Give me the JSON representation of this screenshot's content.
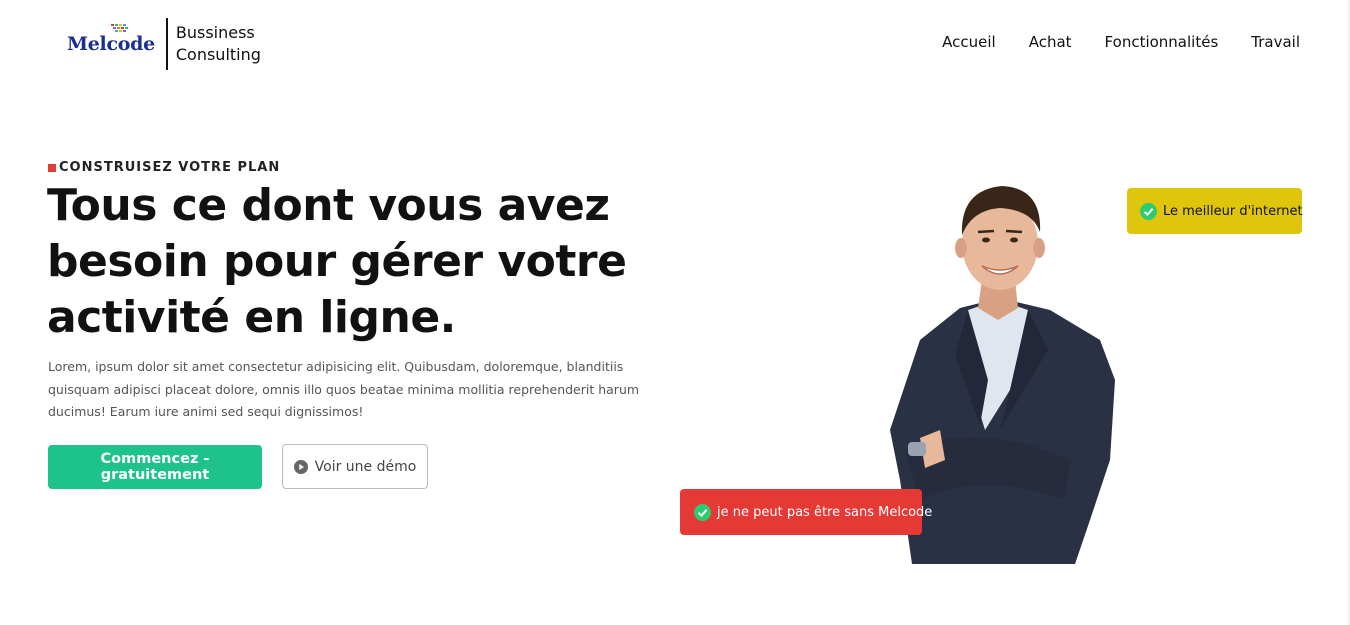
{
  "header": {
    "logo": {
      "brand": "Melcode",
      "tagline_line1": "Bussiness",
      "tagline_line2": "Consulting"
    },
    "nav": [
      {
        "label": "Accueil"
      },
      {
        "label": "Achat"
      },
      {
        "label": "Fonctionnalités"
      },
      {
        "label": "Travail"
      }
    ]
  },
  "hero": {
    "eyebrow": "CONSTRUISEZ VOTRE PLAN",
    "headline": "Tous ce dont vous avez besoin pour gérer votre activité en ligne.",
    "lead": "Lorem, ipsum dolor sit amet consectetur adipisicing elit. Quibusdam, doloremque, blanditiis quisquam adipisci placeat dolore, omnis illo quos beatae minima mollitia reprehenderit harum ducimus! Earum iure animi sed sequi dignissimos!",
    "cta_primary": "Commencez - gratuitement",
    "cta_secondary": "Voir une démo",
    "badge_top": "Le meilleur d'internet",
    "badge_bottom": "je ne peut pas être sans Melcode"
  },
  "icons": {
    "play": "play-circle-icon",
    "check": "check-circle-icon"
  },
  "colors": {
    "accent_red": "#e53935",
    "accent_green": "#1ec28b",
    "badge_yellow": "#dfc60c",
    "brand_blue": "#1c2f8f"
  }
}
